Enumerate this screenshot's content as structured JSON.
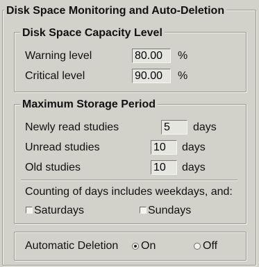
{
  "panel": {
    "title": "Disk Space Monitoring and Auto-Deletion"
  },
  "capacity": {
    "title": "Disk Space Capacity Level",
    "warning_label": "Warning level",
    "warning_value": "80.00",
    "warning_unit": "%",
    "critical_label": "Critical level",
    "critical_value": "90.00",
    "critical_unit": "%"
  },
  "storage": {
    "title": "Maximum Storage Period",
    "newly_read_label": "Newly read studies",
    "newly_read_value": "5",
    "unread_label": "Unread studies",
    "unread_value": "10",
    "old_label": "Old studies",
    "old_value": "10",
    "days_unit": "days",
    "counting_text": "Counting of days includes weekdays, and:",
    "saturdays_label": "Saturdays",
    "saturdays_checked": false,
    "sundays_label": "Sundays",
    "sundays_checked": false
  },
  "auto_deletion": {
    "label": "Automatic Deletion",
    "on_label": "On",
    "off_label": "Off",
    "selected": "On"
  }
}
